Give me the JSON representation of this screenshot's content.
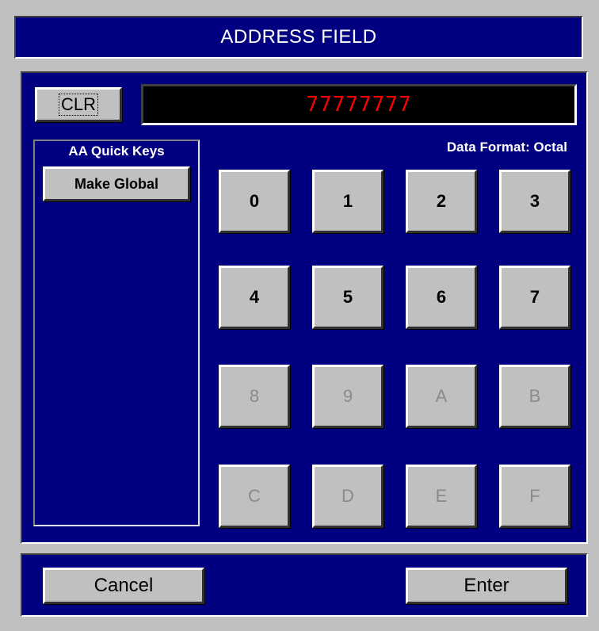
{
  "title": "ADDRESS FIELD",
  "clear_label": "CLR",
  "display_value": "77777777",
  "quick_keys": {
    "title": "AA Quick Keys",
    "make_global_label": "Make Global"
  },
  "data_format_label": "Data Format: Octal",
  "keypad": [
    {
      "label": "0",
      "enabled": true
    },
    {
      "label": "1",
      "enabled": true
    },
    {
      "label": "2",
      "enabled": true
    },
    {
      "label": "3",
      "enabled": true
    },
    {
      "label": "4",
      "enabled": true
    },
    {
      "label": "5",
      "enabled": true
    },
    {
      "label": "6",
      "enabled": true
    },
    {
      "label": "7",
      "enabled": true
    },
    {
      "label": "8",
      "enabled": false
    },
    {
      "label": "9",
      "enabled": false
    },
    {
      "label": "A",
      "enabled": false
    },
    {
      "label": "B",
      "enabled": false
    },
    {
      "label": "C",
      "enabled": false
    },
    {
      "label": "D",
      "enabled": false
    },
    {
      "label": "E",
      "enabled": false
    },
    {
      "label": "F",
      "enabled": false
    }
  ],
  "buttons": {
    "cancel_label": "Cancel",
    "enter_label": "Enter"
  },
  "colors": {
    "panel_background": "#000080",
    "display_text": "#ff0000",
    "display_background": "#000000",
    "button_face": "#c0c0c0",
    "disabled_text": "#8a8a8a"
  }
}
